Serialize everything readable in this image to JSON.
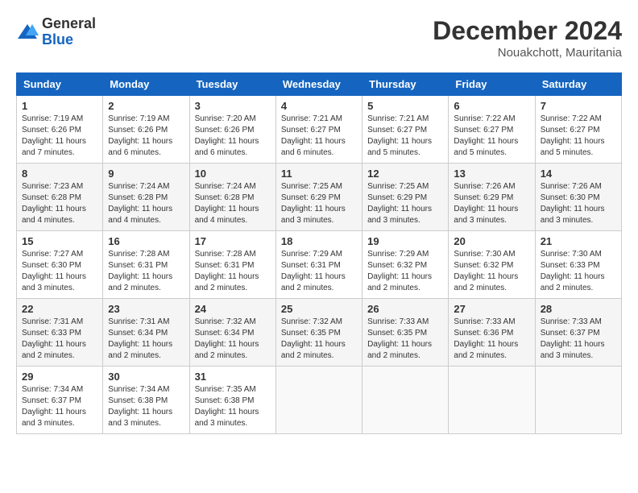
{
  "logo": {
    "general": "General",
    "blue": "Blue"
  },
  "title": "December 2024",
  "location": "Nouakchott, Mauritania",
  "days_of_week": [
    "Sunday",
    "Monday",
    "Tuesday",
    "Wednesday",
    "Thursday",
    "Friday",
    "Saturday"
  ],
  "weeks": [
    [
      {
        "day": "1",
        "sunrise": "7:19 AM",
        "sunset": "6:26 PM",
        "daylight": "11 hours and 7 minutes."
      },
      {
        "day": "2",
        "sunrise": "7:19 AM",
        "sunset": "6:26 PM",
        "daylight": "11 hours and 6 minutes."
      },
      {
        "day": "3",
        "sunrise": "7:20 AM",
        "sunset": "6:26 PM",
        "daylight": "11 hours and 6 minutes."
      },
      {
        "day": "4",
        "sunrise": "7:21 AM",
        "sunset": "6:27 PM",
        "daylight": "11 hours and 6 minutes."
      },
      {
        "day": "5",
        "sunrise": "7:21 AM",
        "sunset": "6:27 PM",
        "daylight": "11 hours and 5 minutes."
      },
      {
        "day": "6",
        "sunrise": "7:22 AM",
        "sunset": "6:27 PM",
        "daylight": "11 hours and 5 minutes."
      },
      {
        "day": "7",
        "sunrise": "7:22 AM",
        "sunset": "6:27 PM",
        "daylight": "11 hours and 5 minutes."
      }
    ],
    [
      {
        "day": "8",
        "sunrise": "7:23 AM",
        "sunset": "6:28 PM",
        "daylight": "11 hours and 4 minutes."
      },
      {
        "day": "9",
        "sunrise": "7:24 AM",
        "sunset": "6:28 PM",
        "daylight": "11 hours and 4 minutes."
      },
      {
        "day": "10",
        "sunrise": "7:24 AM",
        "sunset": "6:28 PM",
        "daylight": "11 hours and 4 minutes."
      },
      {
        "day": "11",
        "sunrise": "7:25 AM",
        "sunset": "6:29 PM",
        "daylight": "11 hours and 3 minutes."
      },
      {
        "day": "12",
        "sunrise": "7:25 AM",
        "sunset": "6:29 PM",
        "daylight": "11 hours and 3 minutes."
      },
      {
        "day": "13",
        "sunrise": "7:26 AM",
        "sunset": "6:29 PM",
        "daylight": "11 hours and 3 minutes."
      },
      {
        "day": "14",
        "sunrise": "7:26 AM",
        "sunset": "6:30 PM",
        "daylight": "11 hours and 3 minutes."
      }
    ],
    [
      {
        "day": "15",
        "sunrise": "7:27 AM",
        "sunset": "6:30 PM",
        "daylight": "11 hours and 3 minutes."
      },
      {
        "day": "16",
        "sunrise": "7:28 AM",
        "sunset": "6:31 PM",
        "daylight": "11 hours and 2 minutes."
      },
      {
        "day": "17",
        "sunrise": "7:28 AM",
        "sunset": "6:31 PM",
        "daylight": "11 hours and 2 minutes."
      },
      {
        "day": "18",
        "sunrise": "7:29 AM",
        "sunset": "6:31 PM",
        "daylight": "11 hours and 2 minutes."
      },
      {
        "day": "19",
        "sunrise": "7:29 AM",
        "sunset": "6:32 PM",
        "daylight": "11 hours and 2 minutes."
      },
      {
        "day": "20",
        "sunrise": "7:30 AM",
        "sunset": "6:32 PM",
        "daylight": "11 hours and 2 minutes."
      },
      {
        "day": "21",
        "sunrise": "7:30 AM",
        "sunset": "6:33 PM",
        "daylight": "11 hours and 2 minutes."
      }
    ],
    [
      {
        "day": "22",
        "sunrise": "7:31 AM",
        "sunset": "6:33 PM",
        "daylight": "11 hours and 2 minutes."
      },
      {
        "day": "23",
        "sunrise": "7:31 AM",
        "sunset": "6:34 PM",
        "daylight": "11 hours and 2 minutes."
      },
      {
        "day": "24",
        "sunrise": "7:32 AM",
        "sunset": "6:34 PM",
        "daylight": "11 hours and 2 minutes."
      },
      {
        "day": "25",
        "sunrise": "7:32 AM",
        "sunset": "6:35 PM",
        "daylight": "11 hours and 2 minutes."
      },
      {
        "day": "26",
        "sunrise": "7:33 AM",
        "sunset": "6:35 PM",
        "daylight": "11 hours and 2 minutes."
      },
      {
        "day": "27",
        "sunrise": "7:33 AM",
        "sunset": "6:36 PM",
        "daylight": "11 hours and 2 minutes."
      },
      {
        "day": "28",
        "sunrise": "7:33 AM",
        "sunset": "6:37 PM",
        "daylight": "11 hours and 3 minutes."
      }
    ],
    [
      {
        "day": "29",
        "sunrise": "7:34 AM",
        "sunset": "6:37 PM",
        "daylight": "11 hours and 3 minutes."
      },
      {
        "day": "30",
        "sunrise": "7:34 AM",
        "sunset": "6:38 PM",
        "daylight": "11 hours and 3 minutes."
      },
      {
        "day": "31",
        "sunrise": "7:35 AM",
        "sunset": "6:38 PM",
        "daylight": "11 hours and 3 minutes."
      },
      null,
      null,
      null,
      null
    ]
  ],
  "labels": {
    "sunrise": "Sunrise:",
    "sunset": "Sunset:",
    "daylight": "Daylight:"
  }
}
